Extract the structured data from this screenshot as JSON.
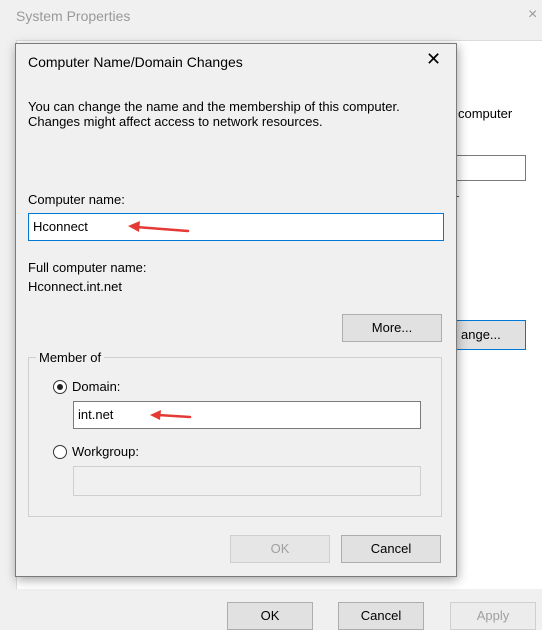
{
  "background_window": {
    "title": "System Properties",
    "close_glyph": "×",
    "text_fragment": "computer",
    "change_button_label": "ange...",
    "buttons": {
      "ok": "OK",
      "cancel": "Cancel",
      "apply": "Apply"
    }
  },
  "dialog": {
    "title": "Computer Name/Domain Changes",
    "close_glyph": "✕",
    "description": "You can change the name and the membership of this computer. Changes might affect access to network resources.",
    "computer_name_label": "Computer name:",
    "computer_name_value": "Hconnect",
    "full_name_label": "Full computer name:",
    "full_name_value": "Hconnect.int.net",
    "more_button": "More...",
    "member_of": {
      "legend": "Member of",
      "selected": "domain",
      "domain_label": "Domain:",
      "domain_value": "int.net",
      "workgroup_label": "Workgroup:",
      "workgroup_value": ""
    },
    "ok_button": "OK",
    "cancel_button": "Cancel"
  },
  "annotation_color": "#e53935",
  "accent_color": "#0078d7"
}
